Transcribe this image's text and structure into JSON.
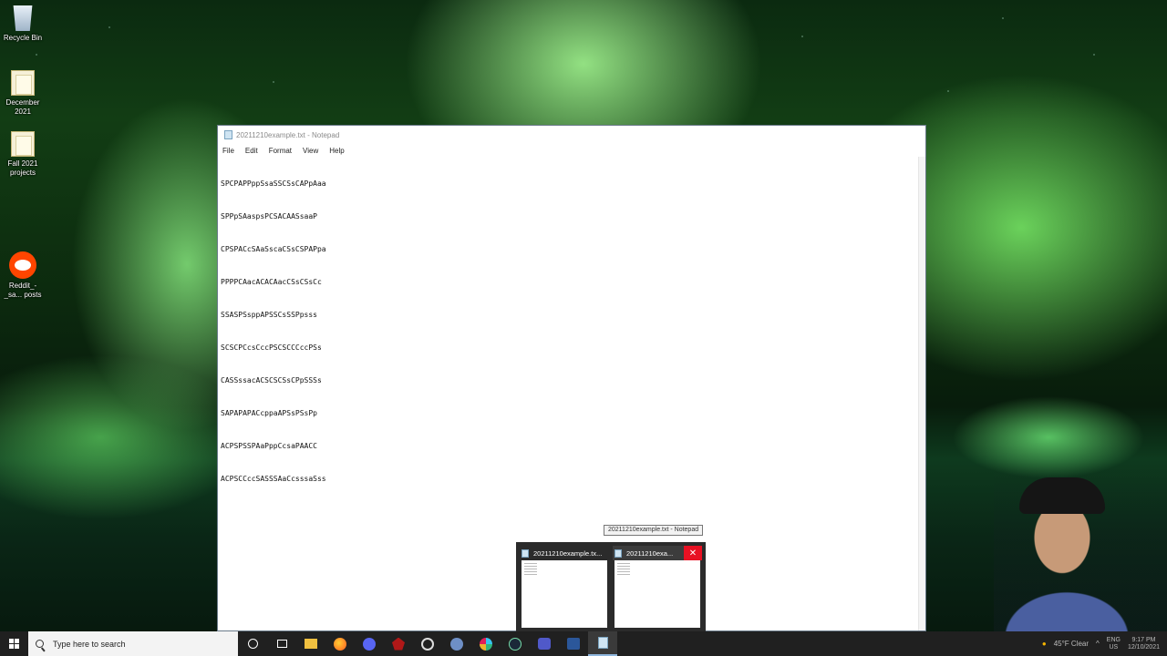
{
  "desktop": {
    "icons": [
      {
        "label": "Recycle Bin",
        "icon": "recycle-bin-icon"
      },
      {
        "label": "December 2021",
        "icon": "folder-icon"
      },
      {
        "label": "Fall 2021 projects",
        "icon": "folder-icon"
      },
      {
        "label": "Reddit_-_sa... posts",
        "icon": "reddit-icon"
      }
    ]
  },
  "notepad": {
    "title": "20211210example.txt - Notepad",
    "menu": [
      "File",
      "Edit",
      "Format",
      "View",
      "Help"
    ],
    "lines": [
      "SPCPAPPppSsaSSCSsCAPpAaa",
      "SPPpSAaspsPCSACAASsaaP",
      "CPSPACcSAaSscaCSsCSPAPpa",
      "PPPPCAacACACAacCSsCSsCc",
      "SSASPSsppAPSSCsSSPpsss",
      "SCSCPCcsCccPSCSCCCccPSs",
      "CASSssacACSCSCSsCPpSSSs",
      "SAPAPAPACcppaAPSsPSsPp",
      "ACPSPSSPAaPppCcsaPAACC",
      "ACPSCCccSASSSAaCcsssaSss"
    ]
  },
  "taskbar_preview": {
    "tooltip": "20211210example.txt - Notepad",
    "thumbnails": [
      {
        "label": "20211210example.tx..."
      },
      {
        "label": "20211210exa..."
      }
    ],
    "close_glyph": "✕"
  },
  "taskbar": {
    "search_placeholder": "Type here to search",
    "apps": [
      "cortana-icon",
      "task-view-icon",
      "file-explorer-icon",
      "firefox-icon",
      "discord-icon",
      "app-red-icon",
      "app-circle-icon",
      "r-icon",
      "slack-icon",
      "steam-icon",
      "teams-icon",
      "word-icon",
      "notepad-icon"
    ],
    "weather": "45°F Clear",
    "language": "ENG",
    "region": "US",
    "time": "9:17 PM",
    "date": "12/10/2021"
  },
  "colors": {
    "taskbar": "#202020",
    "close_red": "#e81123"
  }
}
